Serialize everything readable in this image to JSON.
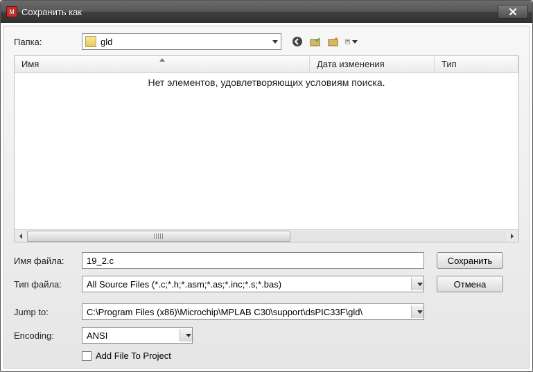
{
  "window": {
    "title": "Сохранить как"
  },
  "folder": {
    "label": "Папка:",
    "name": "gld"
  },
  "columns": {
    "name": "Имя",
    "modified": "Дата изменения",
    "type": "Тип"
  },
  "empty_message": "Нет элементов, удовлетворяющих условиям поиска.",
  "filename": {
    "label": "Имя файла:",
    "value": "19_2.c"
  },
  "filetype": {
    "label": "Тип файла:",
    "value": "All Source Files (*.c;*.h;*.asm;*.as;*.inc;*.s;*.bas)"
  },
  "jumpto": {
    "label": "Jump to:",
    "value": "C:\\Program Files (x86)\\Microchip\\MPLAB C30\\support\\dsPIC33F\\gld\\"
  },
  "encoding": {
    "label": "Encoding:",
    "value": "ANSI"
  },
  "buttons": {
    "save": "Сохранить",
    "cancel": "Отмена"
  },
  "addfile": {
    "label": "Add File To Project",
    "checked": false
  }
}
